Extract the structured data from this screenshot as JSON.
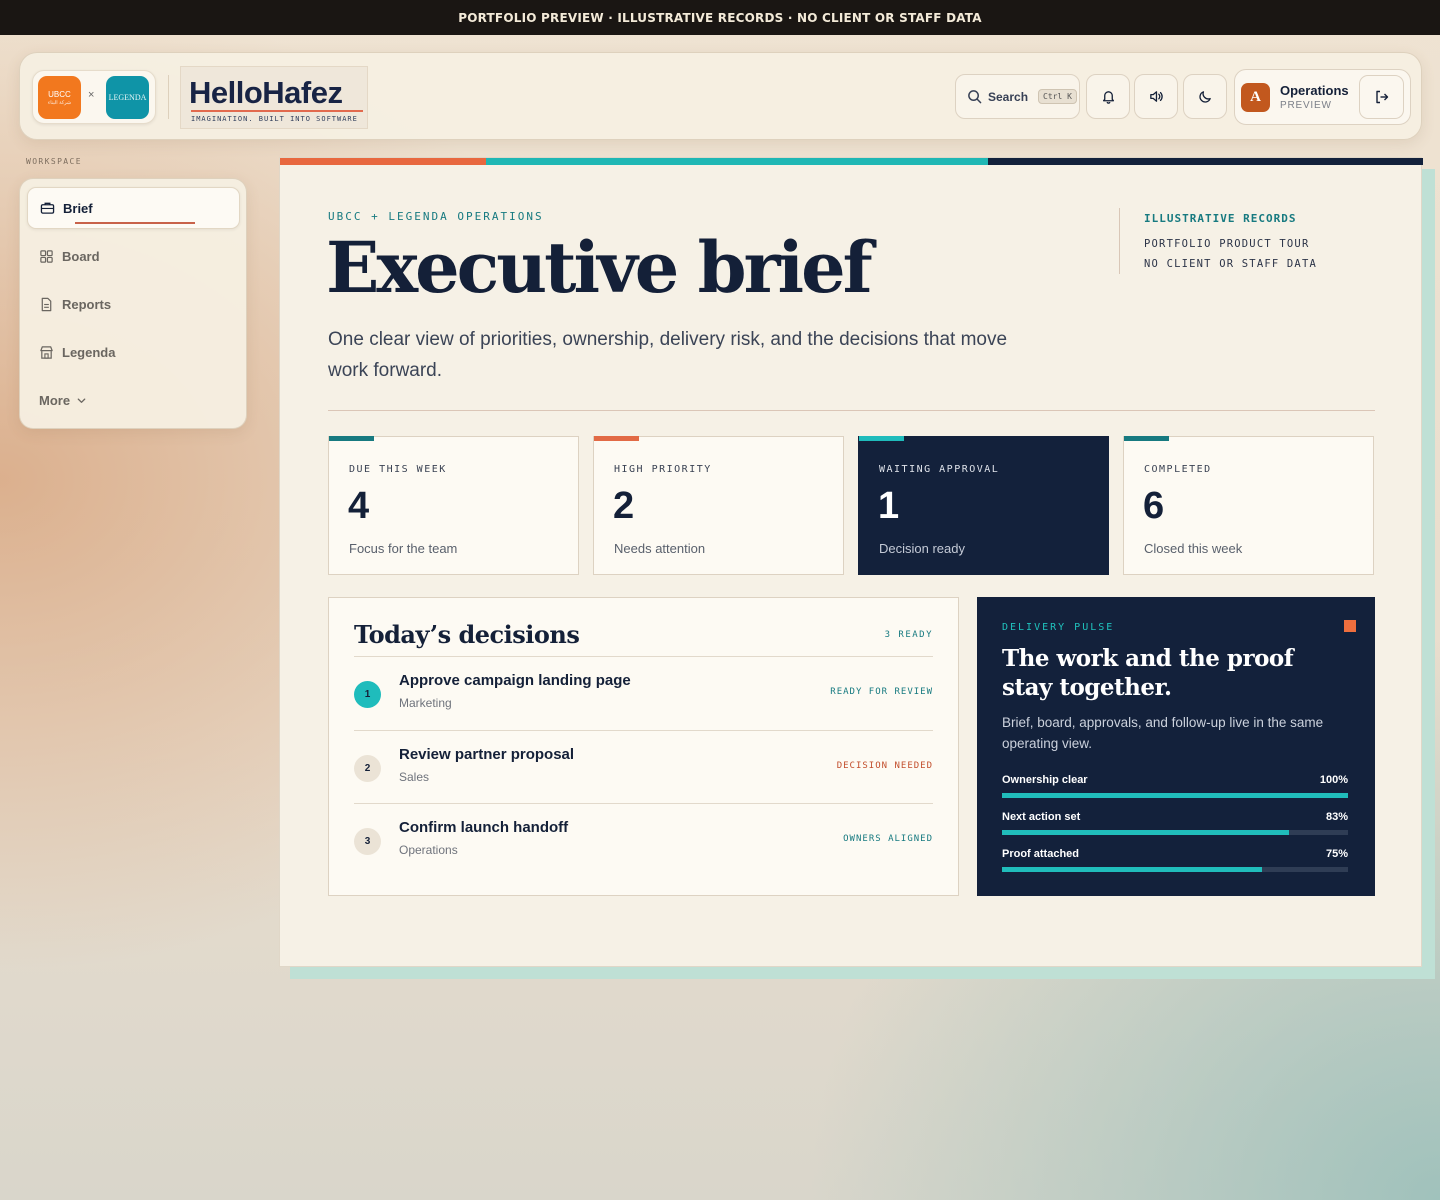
{
  "banner": "PORTFOLIO PREVIEW · ILLUSTRATIVE RECORDS · NO CLIENT OR STAFF DATA",
  "header": {
    "logo_left": "UBCC",
    "logo_left_sub": "شركة البناء",
    "logo_sep": "×",
    "logo_right": "LEGENDA",
    "brand_name": "HelloHafez",
    "brand_tagline": "IMAGINATION. BUILT INTO SOFTWARE",
    "search_label": "Search",
    "search_shortcut": "Ctrl K",
    "user_initial": "A",
    "user_name": "Operations",
    "user_role": "PREVIEW"
  },
  "sidebar": {
    "section_label": "WORKSPACE",
    "items": [
      {
        "label": "Brief",
        "icon": "briefcase-icon"
      },
      {
        "label": "Board",
        "icon": "grid-icon"
      },
      {
        "label": "Reports",
        "icon": "document-icon"
      },
      {
        "label": "Legenda",
        "icon": "store-icon"
      },
      {
        "label": "More",
        "icon": "chevron-down-icon"
      }
    ]
  },
  "main": {
    "eyebrow": "UBCC + LEGENDA OPERATIONS",
    "title": "Executive brief",
    "subtitle": "One clear view of priorities, ownership, delivery risk, and the decisions that move work forward.",
    "note_head": "ILLUSTRATIVE RECORDS",
    "note_line1": "PORTFOLIO PRODUCT TOUR",
    "note_line2": "NO CLIENT OR STAFF DATA",
    "stats": [
      {
        "label": "DUE THIS WEEK",
        "value": "4",
        "desc": "Focus for the team",
        "accent": "#177a80"
      },
      {
        "label": "HIGH PRIORITY",
        "value": "2",
        "desc": "Needs attention",
        "accent": "#e26a45"
      },
      {
        "label": "WAITING APPROVAL",
        "value": "1",
        "desc": "Decision ready",
        "accent": "#1fbcbc"
      },
      {
        "label": "COMPLETED",
        "value": "6",
        "desc": "Closed this week",
        "accent": "#177a80"
      }
    ],
    "decisions": {
      "title": "Today’s decisions",
      "count": "3 READY",
      "items": [
        {
          "num": "1",
          "name": "Approve campaign landing page",
          "team": "Marketing",
          "status": "READY FOR REVIEW",
          "status_color": "#177a80"
        },
        {
          "num": "2",
          "name": "Review partner proposal",
          "team": "Sales",
          "status": "DECISION NEEDED",
          "status_color": "#c24e2c"
        },
        {
          "num": "3",
          "name": "Confirm launch handoff",
          "team": "Operations",
          "status": "OWNERS ALIGNED",
          "status_color": "#177a80"
        }
      ]
    },
    "pulse": {
      "label": "DELIVERY PULSE",
      "title": "The work and the proof stay together.",
      "text": "Brief, board, approvals, and follow-up live in the same operating view.",
      "metrics": [
        {
          "name": "Ownership clear",
          "value": "100%",
          "fraction": 1.0
        },
        {
          "name": "Next action set",
          "value": "83%",
          "fraction": 0.83
        },
        {
          "name": "Proof attached",
          "value": "75%",
          "fraction": 0.75
        }
      ]
    }
  },
  "colors": {
    "navy": "#13213b",
    "teal": "#1fbcbc",
    "orange": "#e26a45",
    "cream": "#f6f1e6"
  }
}
